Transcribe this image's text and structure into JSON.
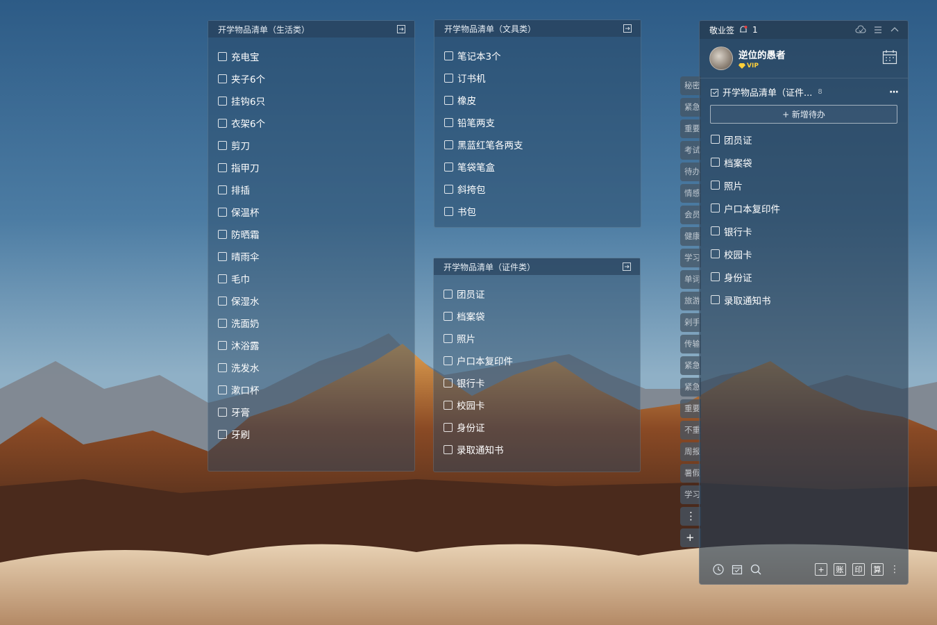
{
  "notes": {
    "life": {
      "title": "开学物品清单（生活类）",
      "items": [
        "充电宝",
        "夹子6个",
        "挂钩6只",
        "衣架6个",
        "剪刀",
        "指甲刀",
        "排插",
        "保温杯",
        "防晒霜",
        "晴雨伞",
        "毛巾",
        "保湿水",
        "洗面奶",
        "沐浴露",
        "洗发水",
        "漱口杯",
        "牙膏",
        "牙刷"
      ]
    },
    "stationery": {
      "title": "开学物品清单（文具类）",
      "items": [
        "笔记本3个",
        "订书机",
        "橡皮",
        "铅笔两支",
        "黑蓝红笔各两支",
        "笔袋笔盒",
        "斜挎包",
        "书包"
      ]
    },
    "documents": {
      "title": "开学物品清单（证件类）",
      "items": [
        "团员证",
        "档案袋",
        "照片",
        "户口本复印件",
        "银行卡",
        "校园卡",
        "身份证",
        "录取通知书"
      ]
    }
  },
  "side_tabs": [
    "秘密",
    "紧急",
    "重要",
    "考试",
    "待办",
    "情感",
    "会员",
    "健康",
    "学习",
    "单词",
    "旅游",
    "剁手",
    "传输",
    "紧急",
    "紧急",
    "重要",
    "不重",
    "周报",
    "暑假",
    "学习"
  ],
  "side_buttons": {
    "more": "⋮",
    "add": "+"
  },
  "main_panel": {
    "app_name": "敬业签",
    "reminder_count": "1",
    "user_name": "逆位的愚者",
    "vip_label": "VIP",
    "list_title": "开学物品清单（证件...",
    "list_count": "8",
    "more_label": "···",
    "add_label": "+ 新增待办",
    "items": [
      "团员证",
      "档案袋",
      "照片",
      "户口本复印件",
      "银行卡",
      "校园卡",
      "身份证",
      "录取通知书"
    ],
    "bottom_buttons": {
      "add": "+",
      "account": "账",
      "print": "印",
      "calc": "算"
    }
  },
  "colors": {
    "vip": "#ffcf3a",
    "reminder_dot": "#e84040"
  }
}
